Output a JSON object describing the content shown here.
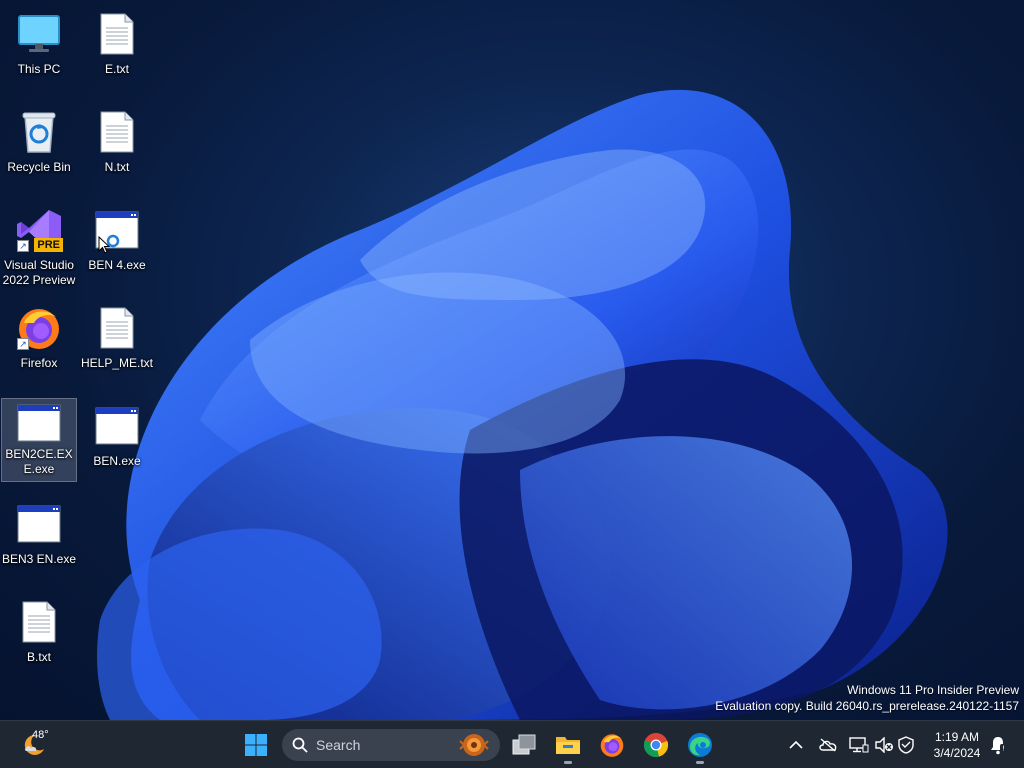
{
  "desktop": {
    "icons": [
      {
        "label": "This PC",
        "icon": "monitor-icon"
      },
      {
        "label": "E.txt",
        "icon": "text-file-icon"
      },
      {
        "label": "Recycle Bin",
        "icon": "recycle-bin-icon"
      },
      {
        "label": "N.txt",
        "icon": "text-file-icon"
      },
      {
        "label": "Visual Studio 2022 Preview",
        "icon": "visual-studio-icon",
        "badge": "PRE"
      },
      {
        "label": "BEN 4.exe",
        "icon": "exe-window-icon"
      },
      {
        "label": "Firefox",
        "icon": "firefox-icon"
      },
      {
        "label": "HELP_ME.txt",
        "icon": "text-file-icon"
      },
      {
        "label": "BEN2CE.EXE.exe",
        "icon": "exe-window-icon",
        "selected": true
      },
      {
        "label": "BEN.exe",
        "icon": "exe-window-icon"
      },
      {
        "label": "BEN3 EN.exe",
        "icon": "exe-window-icon"
      },
      {
        "label": "B.txt",
        "icon": "text-file-icon"
      }
    ],
    "watermark": {
      "line1": "Windows 11 Pro Insider Preview",
      "line2": "Evaluation copy. Build 26040.rs_prerelease.240122-1157"
    }
  },
  "taskbar": {
    "weather": {
      "temp": "48°",
      "icon": "weather-moon-icon"
    },
    "search": {
      "placeholder": "Search"
    },
    "apps": [
      {
        "name": "task-view",
        "icon": "task-view-icon"
      },
      {
        "name": "file-explorer",
        "icon": "folder-icon",
        "running": true
      },
      {
        "name": "firefox",
        "icon": "firefox-icon"
      },
      {
        "name": "chrome",
        "icon": "chrome-icon"
      },
      {
        "name": "edge",
        "icon": "edge-icon",
        "running": true
      }
    ],
    "clock": {
      "time": "1:19 AM",
      "date": "3/4/2024"
    }
  },
  "colors": {
    "taskbar_bg": "#1f2733",
    "accent": "#0078d4"
  }
}
